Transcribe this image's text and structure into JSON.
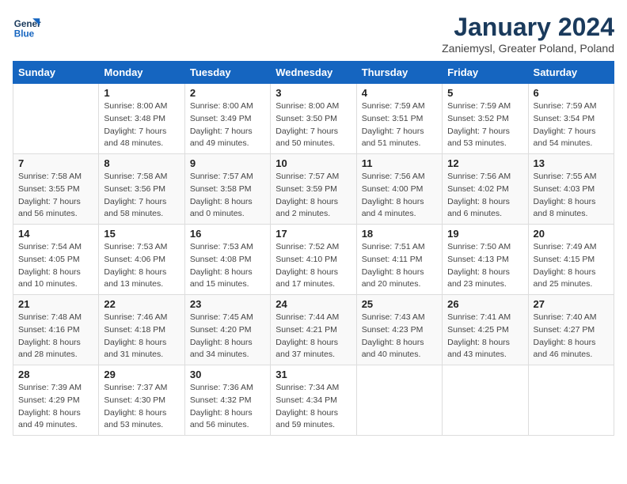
{
  "header": {
    "logo_line1": "General",
    "logo_line2": "Blue",
    "title": "January 2024",
    "subtitle": "Zaniemysl, Greater Poland, Poland"
  },
  "days_of_week": [
    "Sunday",
    "Monday",
    "Tuesday",
    "Wednesday",
    "Thursday",
    "Friday",
    "Saturday"
  ],
  "weeks": [
    [
      {
        "day": "",
        "info": ""
      },
      {
        "day": "1",
        "info": "Sunrise: 8:00 AM\nSunset: 3:48 PM\nDaylight: 7 hours\nand 48 minutes."
      },
      {
        "day": "2",
        "info": "Sunrise: 8:00 AM\nSunset: 3:49 PM\nDaylight: 7 hours\nand 49 minutes."
      },
      {
        "day": "3",
        "info": "Sunrise: 8:00 AM\nSunset: 3:50 PM\nDaylight: 7 hours\nand 50 minutes."
      },
      {
        "day": "4",
        "info": "Sunrise: 7:59 AM\nSunset: 3:51 PM\nDaylight: 7 hours\nand 51 minutes."
      },
      {
        "day": "5",
        "info": "Sunrise: 7:59 AM\nSunset: 3:52 PM\nDaylight: 7 hours\nand 53 minutes."
      },
      {
        "day": "6",
        "info": "Sunrise: 7:59 AM\nSunset: 3:54 PM\nDaylight: 7 hours\nand 54 minutes."
      }
    ],
    [
      {
        "day": "7",
        "info": "Sunrise: 7:58 AM\nSunset: 3:55 PM\nDaylight: 7 hours\nand 56 minutes."
      },
      {
        "day": "8",
        "info": "Sunrise: 7:58 AM\nSunset: 3:56 PM\nDaylight: 7 hours\nand 58 minutes."
      },
      {
        "day": "9",
        "info": "Sunrise: 7:57 AM\nSunset: 3:58 PM\nDaylight: 8 hours\nand 0 minutes."
      },
      {
        "day": "10",
        "info": "Sunrise: 7:57 AM\nSunset: 3:59 PM\nDaylight: 8 hours\nand 2 minutes."
      },
      {
        "day": "11",
        "info": "Sunrise: 7:56 AM\nSunset: 4:00 PM\nDaylight: 8 hours\nand 4 minutes."
      },
      {
        "day": "12",
        "info": "Sunrise: 7:56 AM\nSunset: 4:02 PM\nDaylight: 8 hours\nand 6 minutes."
      },
      {
        "day": "13",
        "info": "Sunrise: 7:55 AM\nSunset: 4:03 PM\nDaylight: 8 hours\nand 8 minutes."
      }
    ],
    [
      {
        "day": "14",
        "info": "Sunrise: 7:54 AM\nSunset: 4:05 PM\nDaylight: 8 hours\nand 10 minutes."
      },
      {
        "day": "15",
        "info": "Sunrise: 7:53 AM\nSunset: 4:06 PM\nDaylight: 8 hours\nand 13 minutes."
      },
      {
        "day": "16",
        "info": "Sunrise: 7:53 AM\nSunset: 4:08 PM\nDaylight: 8 hours\nand 15 minutes."
      },
      {
        "day": "17",
        "info": "Sunrise: 7:52 AM\nSunset: 4:10 PM\nDaylight: 8 hours\nand 17 minutes."
      },
      {
        "day": "18",
        "info": "Sunrise: 7:51 AM\nSunset: 4:11 PM\nDaylight: 8 hours\nand 20 minutes."
      },
      {
        "day": "19",
        "info": "Sunrise: 7:50 AM\nSunset: 4:13 PM\nDaylight: 8 hours\nand 23 minutes."
      },
      {
        "day": "20",
        "info": "Sunrise: 7:49 AM\nSunset: 4:15 PM\nDaylight: 8 hours\nand 25 minutes."
      }
    ],
    [
      {
        "day": "21",
        "info": "Sunrise: 7:48 AM\nSunset: 4:16 PM\nDaylight: 8 hours\nand 28 minutes."
      },
      {
        "day": "22",
        "info": "Sunrise: 7:46 AM\nSunset: 4:18 PM\nDaylight: 8 hours\nand 31 minutes."
      },
      {
        "day": "23",
        "info": "Sunrise: 7:45 AM\nSunset: 4:20 PM\nDaylight: 8 hours\nand 34 minutes."
      },
      {
        "day": "24",
        "info": "Sunrise: 7:44 AM\nSunset: 4:21 PM\nDaylight: 8 hours\nand 37 minutes."
      },
      {
        "day": "25",
        "info": "Sunrise: 7:43 AM\nSunset: 4:23 PM\nDaylight: 8 hours\nand 40 minutes."
      },
      {
        "day": "26",
        "info": "Sunrise: 7:41 AM\nSunset: 4:25 PM\nDaylight: 8 hours\nand 43 minutes."
      },
      {
        "day": "27",
        "info": "Sunrise: 7:40 AM\nSunset: 4:27 PM\nDaylight: 8 hours\nand 46 minutes."
      }
    ],
    [
      {
        "day": "28",
        "info": "Sunrise: 7:39 AM\nSunset: 4:29 PM\nDaylight: 8 hours\nand 49 minutes."
      },
      {
        "day": "29",
        "info": "Sunrise: 7:37 AM\nSunset: 4:30 PM\nDaylight: 8 hours\nand 53 minutes."
      },
      {
        "day": "30",
        "info": "Sunrise: 7:36 AM\nSunset: 4:32 PM\nDaylight: 8 hours\nand 56 minutes."
      },
      {
        "day": "31",
        "info": "Sunrise: 7:34 AM\nSunset: 4:34 PM\nDaylight: 8 hours\nand 59 minutes."
      },
      {
        "day": "",
        "info": ""
      },
      {
        "day": "",
        "info": ""
      },
      {
        "day": "",
        "info": ""
      }
    ]
  ]
}
